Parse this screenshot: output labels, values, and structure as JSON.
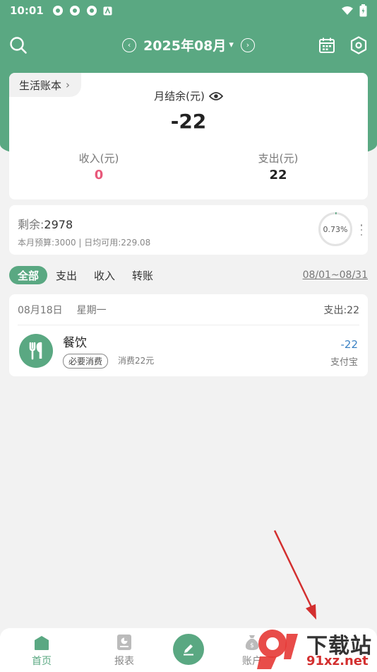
{
  "status": {
    "time": "10:01"
  },
  "header": {
    "month_title": "2025年08月",
    "caret": "▾",
    "prev": "‹",
    "next": "›"
  },
  "summary": {
    "book_name": "生活账本",
    "book_chevron": "›",
    "balance_label": "月结余(元)",
    "balance_value": "-22",
    "income_label": "收入(元)",
    "income_value": "0",
    "expense_label": "支出(元)",
    "expense_value": "22"
  },
  "budget": {
    "remain_label": "剩余:",
    "remain_value": "2978",
    "sub": "本月预算:3000 | 日均可用:229.08",
    "percent_text": "0.73%",
    "percent": 0.0073
  },
  "filters": {
    "items": [
      "全部",
      "支出",
      "收入",
      "转账"
    ],
    "range": "08/01~08/31"
  },
  "record_group": {
    "date": "08月18日",
    "weekday": "星期一",
    "total": "支出:22",
    "record": {
      "category": "餐饮",
      "tag": "必要消费",
      "note": "消费22元",
      "amount": "-22",
      "account": "支付宝"
    }
  },
  "tabbar": {
    "home": "首页",
    "report": "报表",
    "accounts": "账户"
  },
  "watermark": {
    "text": "下载站",
    "url": "91xz.net"
  },
  "colors": {
    "brand": "#5aa882",
    "income": "#e8587a",
    "expense_amount": "#3b82c4",
    "arrow": "#d32f2f"
  }
}
